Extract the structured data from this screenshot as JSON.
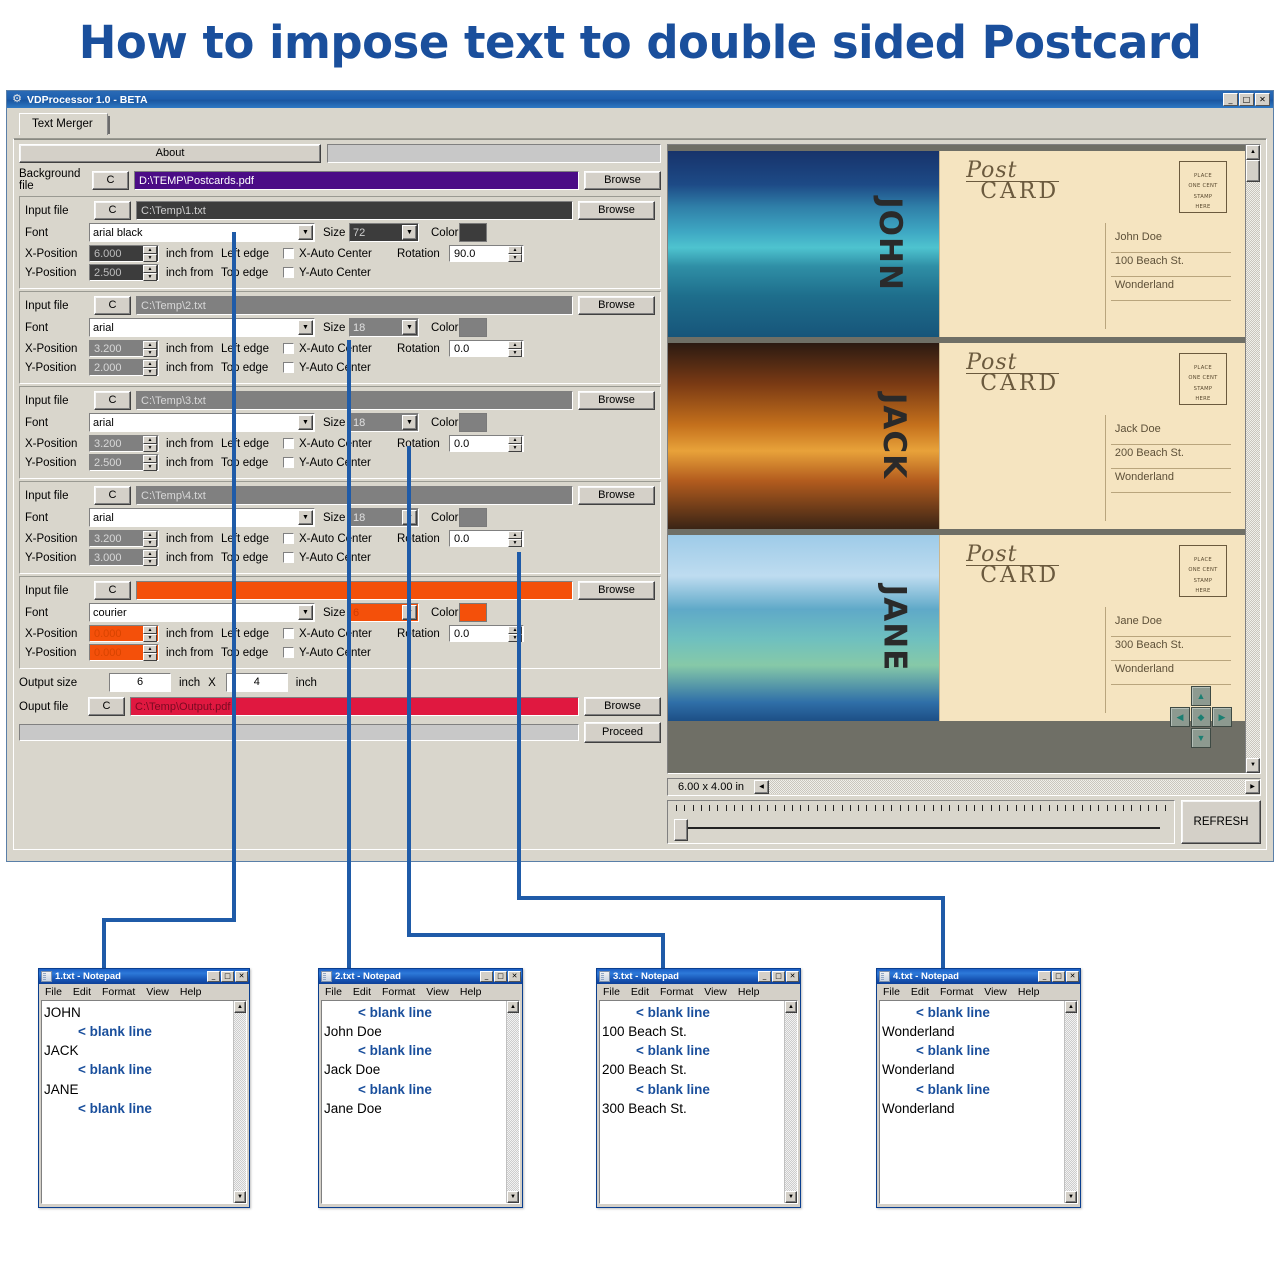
{
  "headline": "How to impose text to double sided Postcard",
  "app": {
    "title": "VDProcessor 1.0 - BETA",
    "icon": "gear-icon",
    "min_label": "_",
    "max_label": "□",
    "close_label": "✕",
    "tab_label": "Text Merger",
    "about_label": "About",
    "background_file": {
      "label": "Background file",
      "c_label": "C",
      "value": "D:\\TEMP\\Postcards.pdf",
      "browse_label": "Browse",
      "color": "#4b0c86"
    },
    "common": {
      "input_label": "Input file",
      "c_label": "C",
      "browse_label": "Browse",
      "font_label": "Font",
      "size_label": "Size",
      "color_label": "Color",
      "x_label": "X-Position",
      "y_label": "Y-Position",
      "inch_from": "inch from",
      "left_edge": "Left edge",
      "top_edge": "Top edge",
      "x_auto": "X-Auto Center",
      "y_auto": "Y-Auto Center",
      "rotation_label": "Rotation"
    },
    "blocks": [
      {
        "file": "C:\\Temp\\1.txt",
        "file_bg": "#3c3c3c",
        "font": "arial black",
        "size": "72",
        "size_bg": "#3c3c3c",
        "color": "#3c3c3c",
        "x": "6.000",
        "y": "2.500",
        "rotation": "90.0",
        "spin_bg": "#3c3c3c"
      },
      {
        "file": "C:\\Temp\\2.txt",
        "file_bg": "#808080",
        "font": "arial",
        "size": "18",
        "size_bg": "#808080",
        "color": "#808080",
        "x": "3.200",
        "y": "2.000",
        "rotation": "0.0",
        "spin_bg": "#808080"
      },
      {
        "file": "C:\\Temp\\3.txt",
        "file_bg": "#808080",
        "font": "arial",
        "size": "18",
        "size_bg": "#808080",
        "color": "#808080",
        "x": "3.200",
        "y": "2.500",
        "rotation": "0.0",
        "spin_bg": "#808080"
      },
      {
        "file": "C:\\Temp\\4.txt",
        "file_bg": "#808080",
        "font": "arial",
        "size": "18",
        "size_bg": "#808080",
        "color": "#808080",
        "x": "3.200",
        "y": "3.000",
        "rotation": "0.0",
        "spin_bg": "#808080"
      },
      {
        "file": "",
        "file_bg": "#f4500a",
        "font": "courier",
        "size": "6",
        "size_bg": "#f4500a",
        "color": "#f4500a",
        "x": "0.000",
        "y": "0.000",
        "rotation": "0.0",
        "spin_bg": "#f4500a"
      }
    ],
    "output": {
      "size_label": "Output size",
      "width": "6",
      "x_sep": "X",
      "height": "4",
      "inch_label": "inch",
      "file_label": "Ouput file",
      "c_label": "C",
      "file_value": "C:\\Temp\\Output.pdf",
      "file_color": "#e01840",
      "browse_label": "Browse",
      "proceed_label": "Proceed"
    },
    "preview": {
      "size_readout": "6.00 x 4.00 in",
      "refresh_label": "REFRESH",
      "cards": [
        {
          "vertical_text": "JOHN",
          "post_word": "Post",
          "card_word": "CARD",
          "stamp": "PLACE\nONE CENT\nSTAMP\nHERE",
          "name": "John Doe",
          "street": "100 Beach St.",
          "city": "Wonderland",
          "photo": "island-aerial"
        },
        {
          "vertical_text": "JACK",
          "post_word": "Post",
          "card_word": "CARD",
          "stamp": "PLACE\nONE CENT\nSTAMP\nHERE",
          "name": "Jack Doe",
          "street": "200 Beach St.",
          "city": "Wonderland",
          "photo": "palm-sunset"
        },
        {
          "vertical_text": "JANE",
          "post_word": "Post",
          "card_word": "CARD",
          "stamp": "PLACE\nONE CENT\nSTAMP\nHERE",
          "name": "Jane Doe",
          "street": "300 Beach St.",
          "city": "Wonderland",
          "photo": "palm-beach"
        }
      ]
    }
  },
  "notepads": [
    {
      "title": "1.txt - Notepad",
      "menu": [
        "File",
        "Edit",
        "Format",
        "View",
        "Help"
      ],
      "lines": [
        {
          "type": "text",
          "value": "JOHN"
        },
        {
          "type": "blank",
          "value": "< blank line"
        },
        {
          "type": "text",
          "value": "JACK"
        },
        {
          "type": "blank",
          "value": "< blank line"
        },
        {
          "type": "text",
          "value": "JANE"
        },
        {
          "type": "blank",
          "value": "< blank line"
        }
      ]
    },
    {
      "title": "2.txt - Notepad",
      "menu": [
        "File",
        "Edit",
        "Format",
        "View",
        "Help"
      ],
      "lines": [
        {
          "type": "blank",
          "value": "< blank line"
        },
        {
          "type": "text",
          "value": "John Doe"
        },
        {
          "type": "blank",
          "value": "< blank line"
        },
        {
          "type": "text",
          "value": "Jack Doe"
        },
        {
          "type": "blank",
          "value": "< blank line"
        },
        {
          "type": "text",
          "value": "Jane Doe"
        }
      ]
    },
    {
      "title": "3.txt - Notepad",
      "menu": [
        "File",
        "Edit",
        "Format",
        "View",
        "Help"
      ],
      "lines": [
        {
          "type": "blank",
          "value": "< blank line"
        },
        {
          "type": "text",
          "value": "100 Beach St."
        },
        {
          "type": "blank",
          "value": "< blank line"
        },
        {
          "type": "text",
          "value": "200 Beach St."
        },
        {
          "type": "blank",
          "value": "< blank line"
        },
        {
          "type": "text",
          "value": "300 Beach St."
        }
      ]
    },
    {
      "title": "4.txt - Notepad",
      "menu": [
        "File",
        "Edit",
        "Format",
        "View",
        "Help"
      ],
      "lines": [
        {
          "type": "blank",
          "value": "< blank line"
        },
        {
          "type": "text",
          "value": "Wonderland"
        },
        {
          "type": "blank",
          "value": "< blank line"
        },
        {
          "type": "text",
          "value": "Wonderland"
        },
        {
          "type": "blank",
          "value": "< blank line"
        },
        {
          "type": "text",
          "value": "Wonderland"
        }
      ]
    }
  ],
  "np_controls": {
    "min": "_",
    "max": "□",
    "close": "✕"
  },
  "connector_color": "#1f5ba8"
}
